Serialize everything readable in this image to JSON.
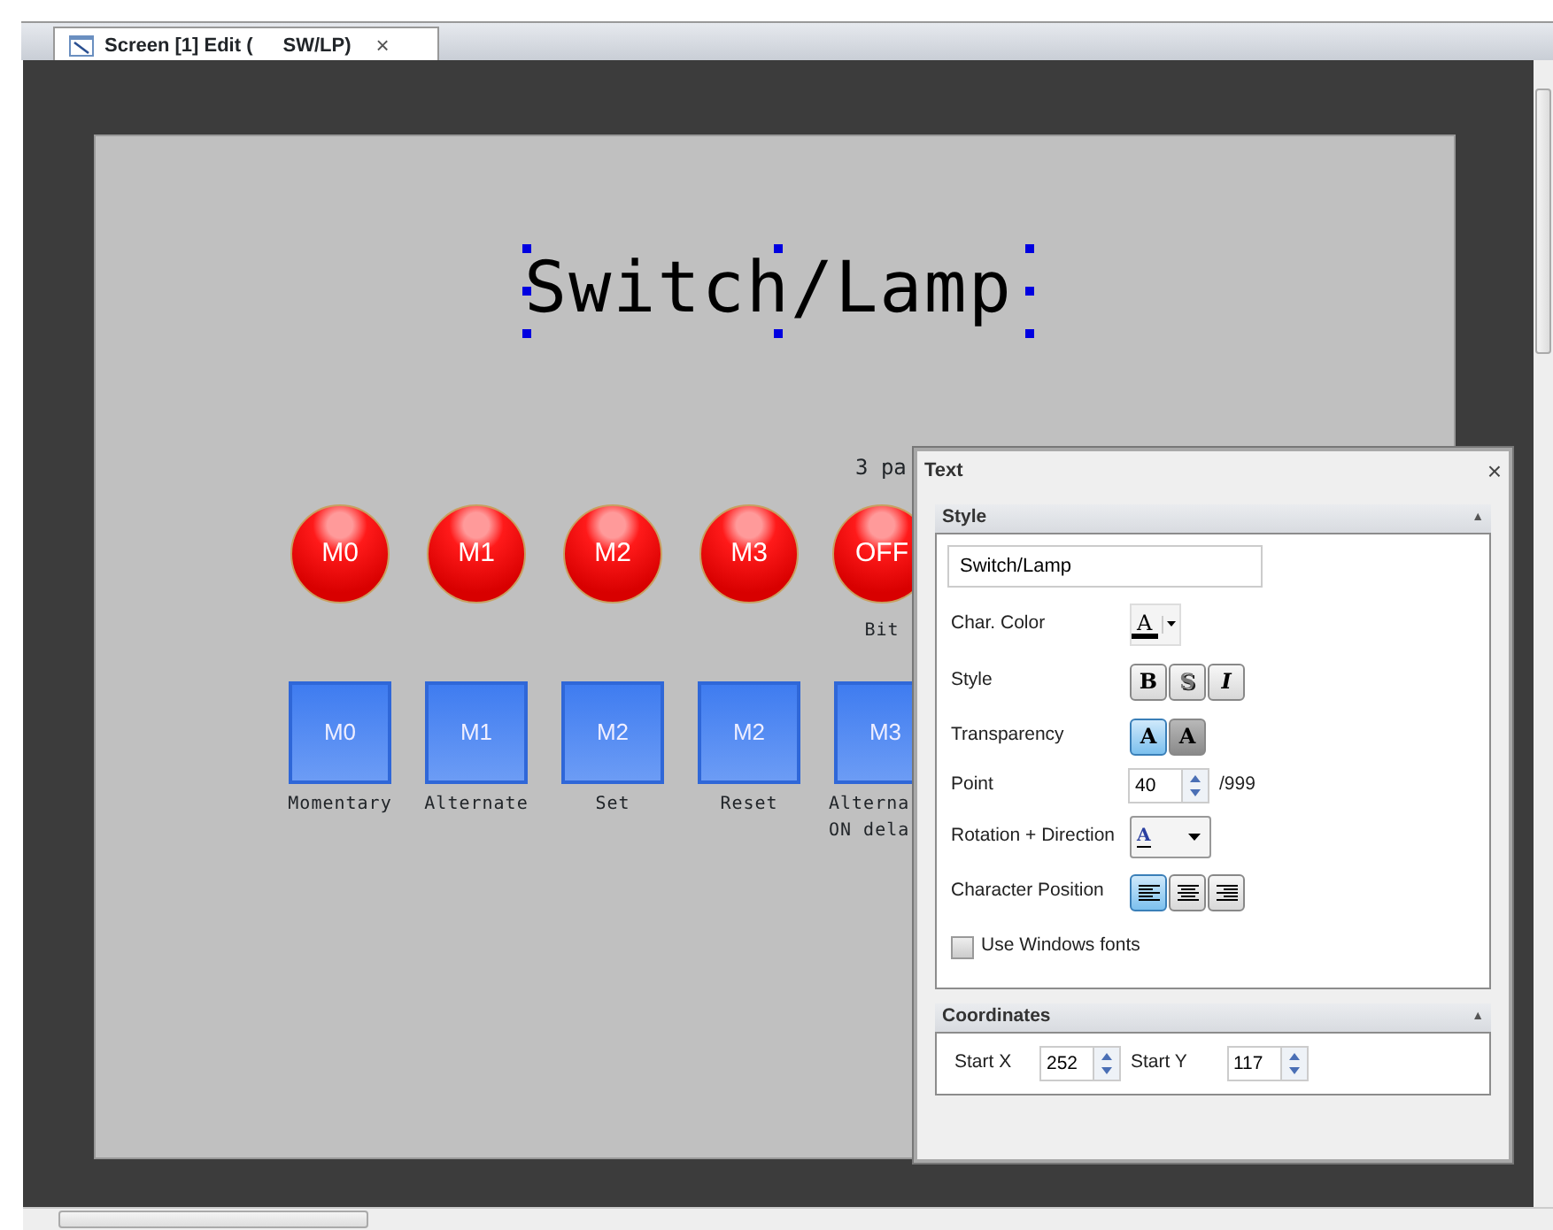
{
  "tab": {
    "title": "Screen [1] Edit (",
    "title_2": "SW/LP)",
    "close": "×",
    "selected": true
  },
  "canvas": {
    "title": "Switch/Lamp",
    "note": "3 pa",
    "lamps": [
      {
        "label": "M0"
      },
      {
        "label": "M1"
      },
      {
        "label": "M2"
      },
      {
        "label": "M3"
      },
      {
        "label": "OFF",
        "caption": "Bit"
      }
    ],
    "buttons": [
      {
        "label": "M0",
        "caption": [
          "Momentary"
        ]
      },
      {
        "label": "M1",
        "caption": [
          "Alternate"
        ]
      },
      {
        "label": "M2",
        "caption": [
          "Set"
        ]
      },
      {
        "label": "M2",
        "caption": [
          "Reset"
        ]
      },
      {
        "label": "M3",
        "caption": [
          "Alterna",
          "ON dela"
        ]
      }
    ]
  },
  "panel": {
    "title": "Text",
    "close": "×",
    "style": {
      "header": "Style",
      "collapse": "▲",
      "text_value": "Switch/Lamp",
      "char_color": {
        "label": "Char. Color",
        "glyph": "A"
      },
      "style_row": {
        "label": "Style",
        "buttons": [
          {
            "glyph": "B",
            "selected": false
          },
          {
            "glyph": "S",
            "selected": false
          },
          {
            "glyph": "I",
            "selected": false
          }
        ]
      },
      "transparency": {
        "label": "Transparency",
        "buttons": [
          {
            "glyph": "A",
            "selected": true
          },
          {
            "glyph": "A",
            "selected": false
          }
        ]
      },
      "point": {
        "label": "Point",
        "value": "40",
        "suffix": "/999"
      },
      "rotation": {
        "label": "Rotation + Direction",
        "glyph": "A"
      },
      "position": {
        "label": "Character Position",
        "buttons": [
          {
            "kind": "left",
            "selected": true
          },
          {
            "kind": "center",
            "selected": false
          },
          {
            "kind": "right",
            "selected": false
          }
        ]
      },
      "windows_fonts": {
        "label": "Use Windows fonts",
        "checked": false
      }
    },
    "coordinates": {
      "header": "Coordinates",
      "collapse": "▲",
      "start_x": {
        "label": "Start X",
        "value": "252"
      },
      "start_y": {
        "label": "Start Y",
        "value": "117"
      }
    }
  }
}
